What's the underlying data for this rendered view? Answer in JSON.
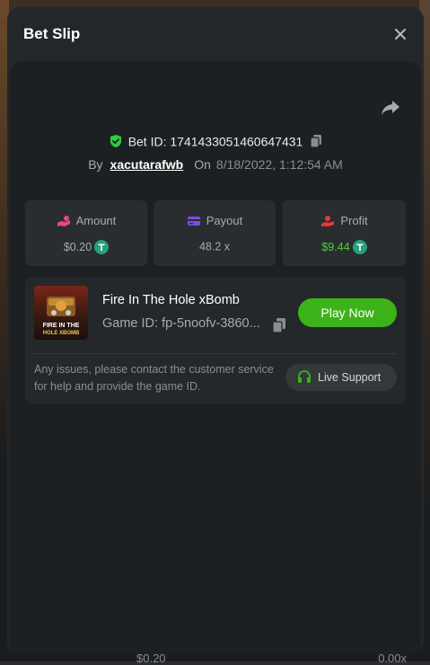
{
  "background": {
    "amount": "$0.20",
    "multiplier": "0.00x"
  },
  "modal": {
    "title": "Bet Slip"
  },
  "bet": {
    "id_text": "Bet ID: 1741433051460647431",
    "by_label": "By",
    "username": "xacutarafwb",
    "on_label": "On",
    "date": "8/18/2022, 1:12:54 AM"
  },
  "stats": [
    {
      "label": "Amount",
      "value": "$0.20"
    },
    {
      "label": "Payout",
      "value": "48.2 x"
    },
    {
      "label": "Profit",
      "value": "$9.44"
    }
  ],
  "game": {
    "name": "Fire In The Hole xBomb",
    "id_text": "Game ID: fp-5noofv-3860...",
    "thumb_line1": "FIRE IN THE",
    "thumb_line2": "HOLE XBOMB",
    "play_label": "Play Now",
    "support_text": "Any issues, please contact the customer service for help and provide the game ID.",
    "support_label": "Live Support"
  },
  "icons": {
    "close": "close-icon",
    "share": "share-icon",
    "verified": "shield-check-icon",
    "copy": "copy-icon",
    "amount": "coins-hand-icon",
    "payout": "card-icon",
    "profit": "hand-money-icon",
    "token": "tether-token-icon",
    "support": "headset-icon"
  },
  "colors": {
    "accent_green": "#3db31a",
    "profit_green": "#4cd137",
    "verified_green": "#2ecc40",
    "amount_icon": "#e84a7a",
    "payout_icon": "#7b4ce8",
    "profit_icon": "#e83a3a",
    "token": "#26a17b"
  }
}
